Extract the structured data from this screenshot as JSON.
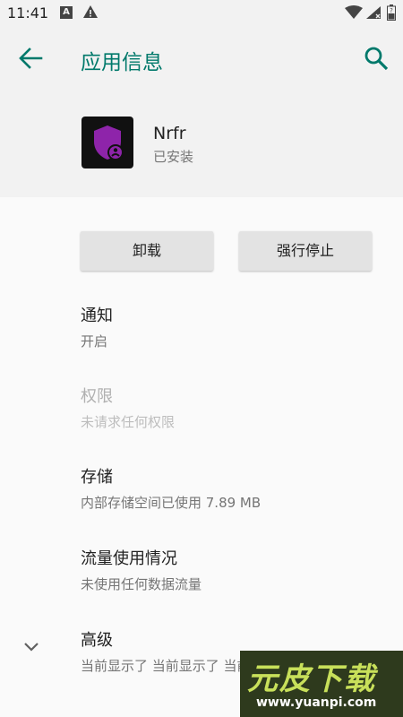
{
  "status_bar": {
    "time": "11:41",
    "notification_letter": "A"
  },
  "app_bar": {
    "title": "应用信息",
    "back_icon": "arrow-back-icon",
    "search_icon": "search-icon"
  },
  "app": {
    "name": "Nrfr",
    "status": "已安装",
    "icon": "shield-person-icon",
    "icon_colors": {
      "background": "#111111",
      "shield": "#8e24aa"
    }
  },
  "buttons": {
    "uninstall": "卸载",
    "force_stop": "强行停止"
  },
  "items": [
    {
      "title": "通知",
      "subtitle": "开启",
      "enabled": true
    },
    {
      "title": "权限",
      "subtitle": "未请求任何权限",
      "enabled": false
    },
    {
      "title": "存储",
      "subtitle": "内部存储空间已使用 7.89 MB",
      "enabled": true
    },
    {
      "title": "流量使用情况",
      "subtitle": "未使用任何数据流量",
      "enabled": true
    },
    {
      "title": "高级",
      "subtitle": "当前显示了 当前显示了 当前显示了 电池",
      "enabled": true
    }
  ],
  "watermark": {
    "text": "元皮下载",
    "url": "www.yuanpi.com"
  },
  "colors": {
    "accent": "#00796b",
    "background": "#fafafa",
    "header_background": "#f2f2f2"
  }
}
